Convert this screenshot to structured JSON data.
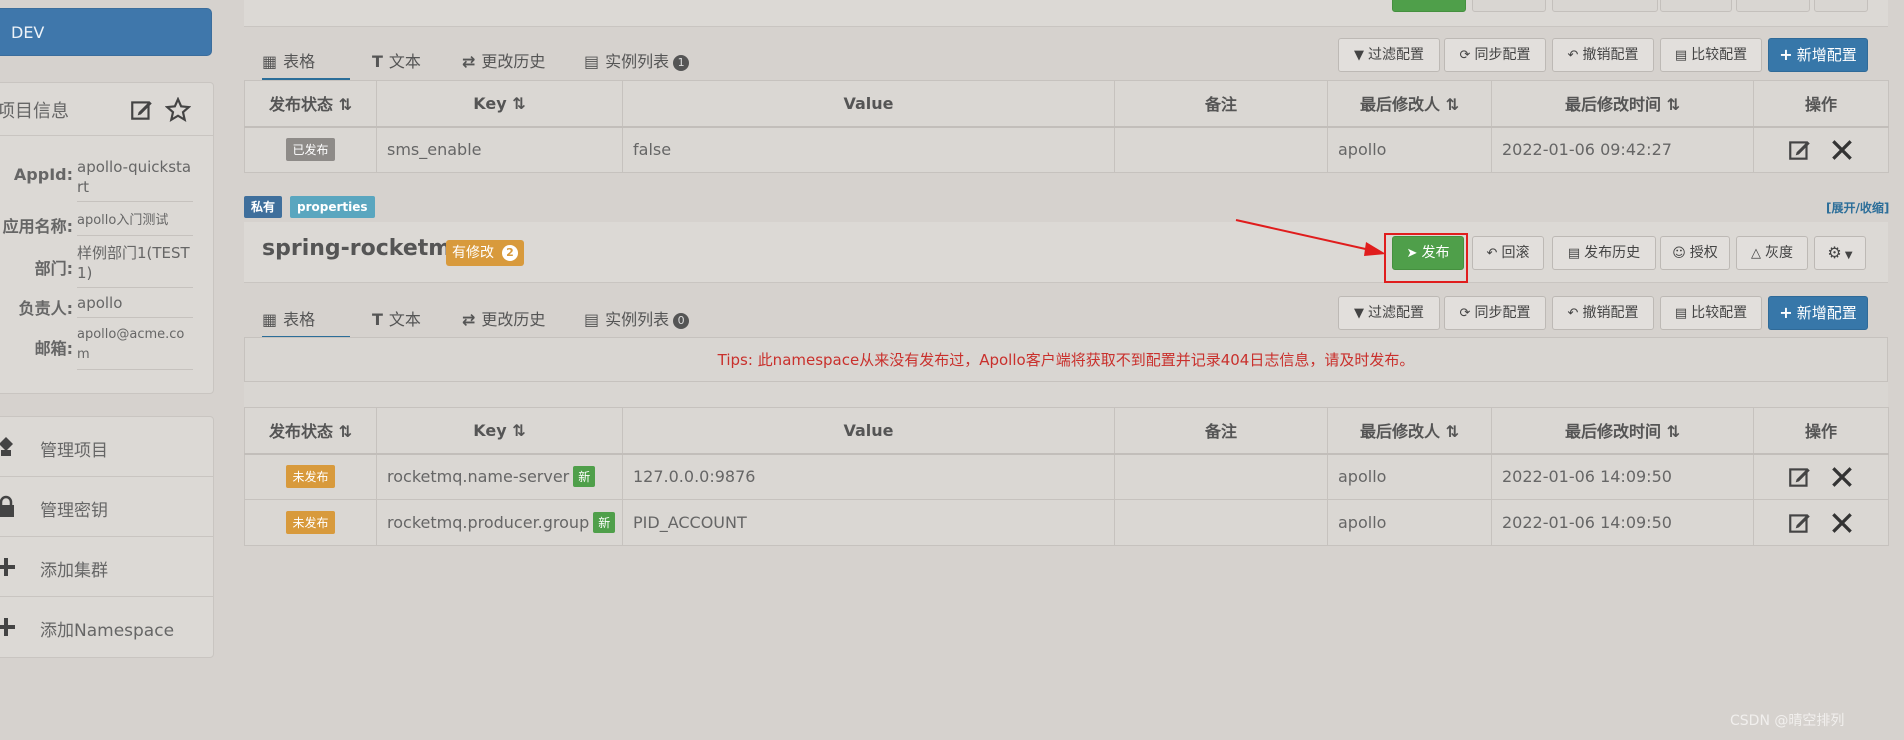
{
  "sidebar": {
    "env": "DEV",
    "info_title": "项目信息",
    "info": [
      {
        "label": "AppId:",
        "value": "apollo-quickstart"
      },
      {
        "label": "应用名称:",
        "value": "apollo入门测试"
      },
      {
        "label": "部门:",
        "value": "样例部门1(TEST1)"
      },
      {
        "label": "负责人:",
        "value": "apollo"
      },
      {
        "label": "邮箱:",
        "value": "apollo@acme.com"
      }
    ],
    "menu": [
      {
        "label": "管理项目",
        "icon": "tree-icon"
      },
      {
        "label": "管理密钥",
        "icon": "lock-icon"
      },
      {
        "label": "添加集群",
        "icon": "plus-icon"
      },
      {
        "label": "添加Namespace",
        "icon": "plus-icon"
      }
    ]
  },
  "ns1": {
    "tabs": {
      "table": "表格",
      "text": "文本",
      "history": "更改历史",
      "instances": "实例列表",
      "instances_count": "1"
    },
    "toolbar": {
      "filter": "过滤配置",
      "sync": "同步配置",
      "revoke": "撤销配置",
      "compare": "比较配置",
      "add": "新增配置"
    },
    "columns": {
      "status": "发布状态",
      "key": "Key",
      "value": "Value",
      "comment": "备注",
      "modifier": "最后修改人",
      "time": "最后修改时间",
      "ops": "操作"
    },
    "rows": [
      {
        "status": "已发布",
        "key": "sms_enable",
        "value": "false",
        "comment": "",
        "modifier": "apollo",
        "time": "2022-01-06 09:42:27"
      }
    ]
  },
  "ns2": {
    "tag_private": "私有",
    "tag_format": "properties",
    "expand": "[展开/收缩]",
    "title": "spring-rocketmq",
    "modified_label": "有修改",
    "modified_count": "2",
    "actions": {
      "publish": "发布",
      "rollback": "回滚",
      "history": "发布历史",
      "auth": "授权",
      "gray": "灰度"
    },
    "tabs": {
      "table": "表格",
      "text": "文本",
      "history": "更改历史",
      "instances": "实例列表",
      "instances_count": "0"
    },
    "toolbar": {
      "filter": "过滤配置",
      "sync": "同步配置",
      "revoke": "撤销配置",
      "compare": "比较配置",
      "add": "新增配置"
    },
    "tips": "Tips: 此namespace从来没有发布过，Apollo客户端将获取不到配置并记录404日志信息，请及时发布。",
    "columns": {
      "status": "发布状态",
      "key": "Key",
      "value": "Value",
      "comment": "备注",
      "modifier": "最后修改人",
      "time": "最后修改时间",
      "ops": "操作"
    },
    "new_label": "新",
    "rows": [
      {
        "status": "未发布",
        "key": "rocketmq.name-server",
        "value": "127.0.0.0:9876",
        "comment": "",
        "modifier": "apollo",
        "time": "2022-01-06 14:09:50"
      },
      {
        "status": "未发布",
        "key": "rocketmq.producer.group",
        "value": "PID_ACCOUNT",
        "comment": "",
        "modifier": "apollo",
        "time": "2022-01-06 14:09:50"
      }
    ]
  },
  "watermark": "CSDN @晴空排列",
  "colors": {
    "primary": "#3777a9",
    "success": "#4f9f4a",
    "warning": "#d89a3c",
    "danger": "#c9302c",
    "highlight": "#e01d1d"
  }
}
